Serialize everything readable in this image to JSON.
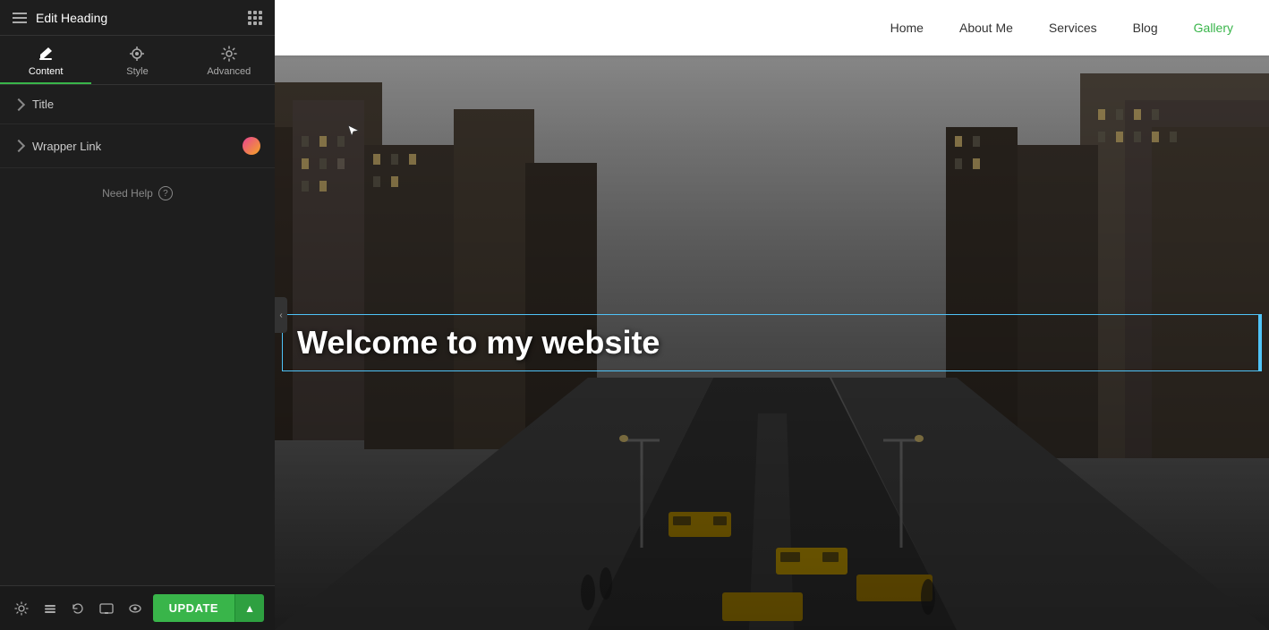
{
  "panel": {
    "title": "Edit Heading",
    "tabs": [
      {
        "id": "content",
        "label": "Content",
        "icon": "content-icon",
        "active": true
      },
      {
        "id": "style",
        "label": "Style",
        "icon": "style-icon",
        "active": false
      },
      {
        "id": "advanced",
        "label": "Advanced",
        "icon": "advanced-icon",
        "active": false
      }
    ],
    "sections": [
      {
        "id": "title",
        "label": "Title",
        "expanded": false
      },
      {
        "id": "wrapper-link",
        "label": "Wrapper Link",
        "expanded": false,
        "has_icon": true
      }
    ],
    "help_label": "Need Help",
    "update_button_label": "UPDATE"
  },
  "nav": {
    "items": [
      {
        "id": "home",
        "label": "Home",
        "active": false
      },
      {
        "id": "about-me",
        "label": "About Me",
        "active": false
      },
      {
        "id": "services",
        "label": "Services",
        "active": false
      },
      {
        "id": "blog",
        "label": "Blog",
        "active": false
      },
      {
        "id": "gallery",
        "label": "Gallery",
        "active": true
      }
    ]
  },
  "preview": {
    "heading_text": "Welcome to my website"
  },
  "colors": {
    "accent_green": "#39b54a",
    "selection_blue": "#4fc3f7",
    "panel_bg": "#1e1e1e",
    "panel_text": "#cccccc"
  }
}
